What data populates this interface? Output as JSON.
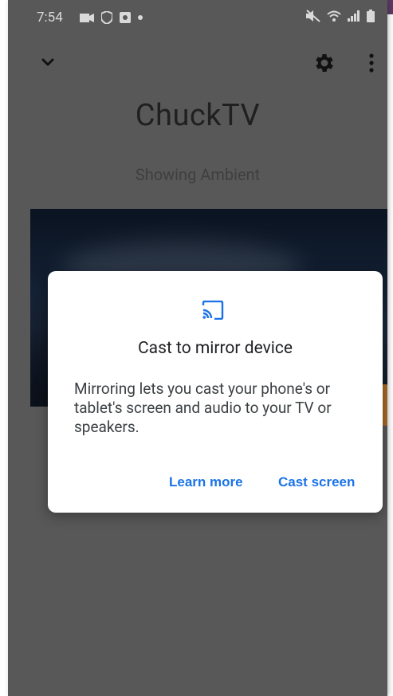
{
  "status_bar": {
    "time": "7:54",
    "left_icons": [
      "video-icon",
      "shield-icon",
      "camera-icon",
      "dot-icon"
    ],
    "right_icons": [
      "mute-icon",
      "wifi-icon",
      "signal-icon",
      "battery-icon"
    ]
  },
  "header": {
    "device_name": "ChuckTV",
    "status": "Showing Ambient"
  },
  "dialog": {
    "title": "Cast to mirror device",
    "body": "Mirroring lets you cast your phone's or tablet's screen and audio to your TV or speakers.",
    "learn_more_label": "Learn more",
    "cast_screen_label": "Cast screen",
    "accent_color": "#1a73e8"
  }
}
